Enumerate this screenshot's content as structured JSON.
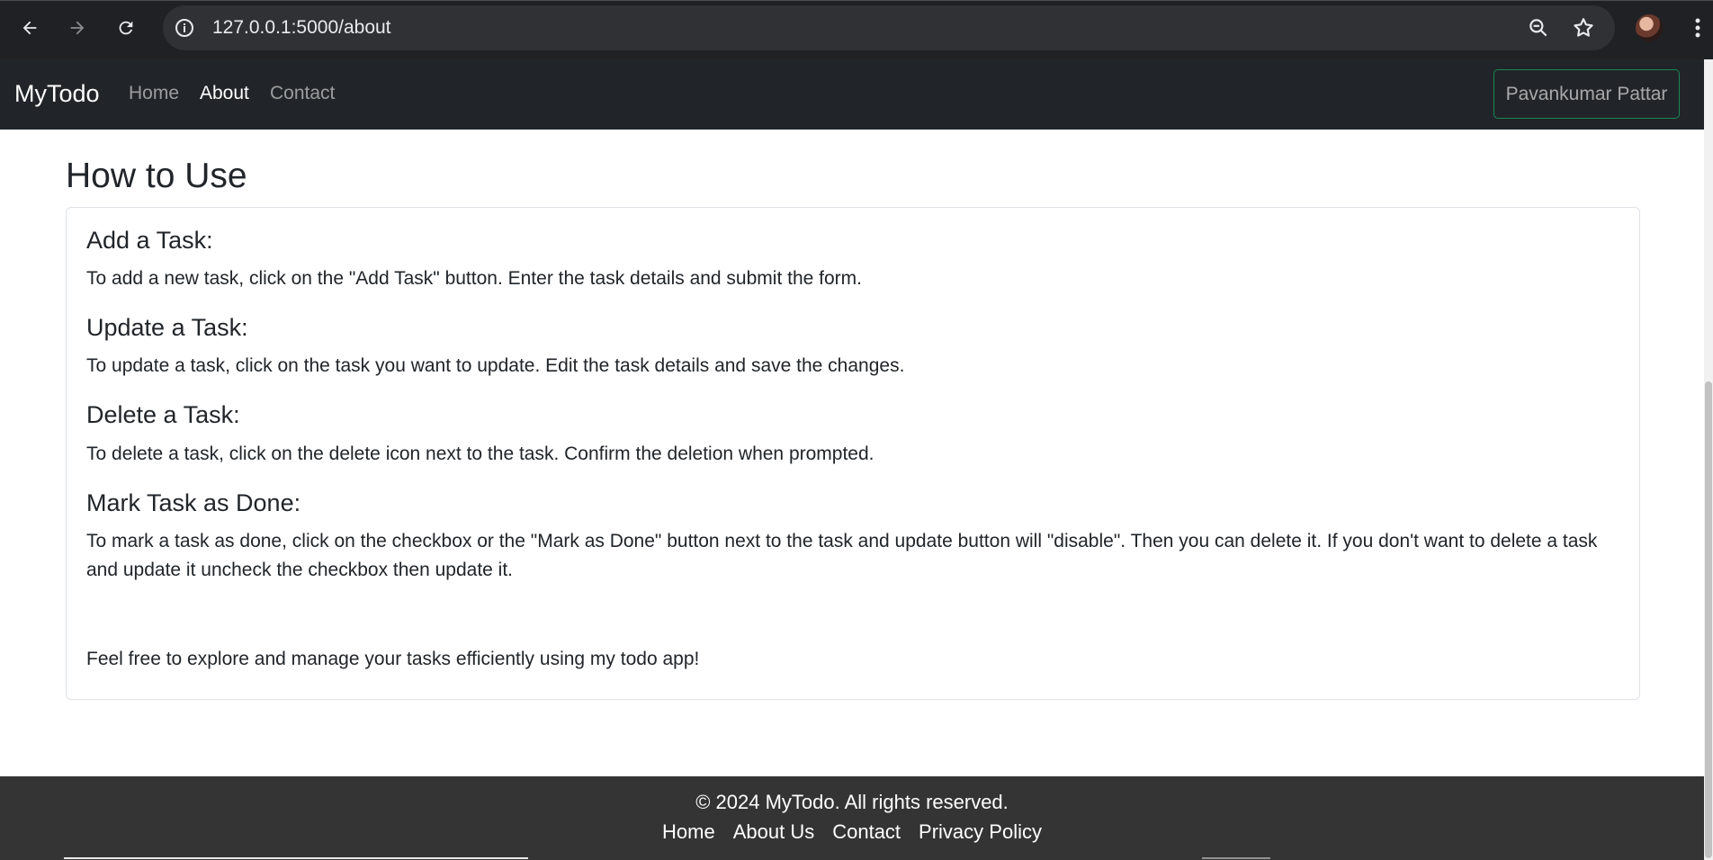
{
  "browser": {
    "url": "127.0.0.1:5000/about"
  },
  "navbar": {
    "brand": "MyTodo",
    "links": [
      {
        "label": "Home",
        "active": false
      },
      {
        "label": "About",
        "active": true
      },
      {
        "label": "Contact",
        "active": false
      }
    ],
    "user_button": "Pavankumar Pattar"
  },
  "main": {
    "title": "How to Use",
    "sections": [
      {
        "heading": "Add a Task:",
        "text": "To add a new task, click on the \"Add Task\" button. Enter the task details and submit the form."
      },
      {
        "heading": "Update a Task:",
        "text": "To update a task, click on the task you want to update. Edit the task details and save the changes."
      },
      {
        "heading": "Delete a Task:",
        "text": "To delete a task, click on the delete icon next to the task. Confirm the deletion when prompted."
      },
      {
        "heading": "Mark Task as Done:",
        "text": "To mark a task as done, click on the checkbox or the \"Mark as Done\" button next to the task and update button will \"disable\". Then you can delete it. If you don't want to delete a task and update it uncheck the checkbox then update it."
      }
    ],
    "closing": "Feel free to explore and manage your tasks efficiently using my todo app!"
  },
  "footer": {
    "copyright": "© 2024 MyTodo. All rights reserved.",
    "links": [
      "Home",
      "About Us",
      "Contact",
      "Privacy Policy"
    ]
  },
  "colors": {
    "navbar_bg": "#212529",
    "footer_bg": "#343434",
    "user_button_border": "#198754"
  }
}
